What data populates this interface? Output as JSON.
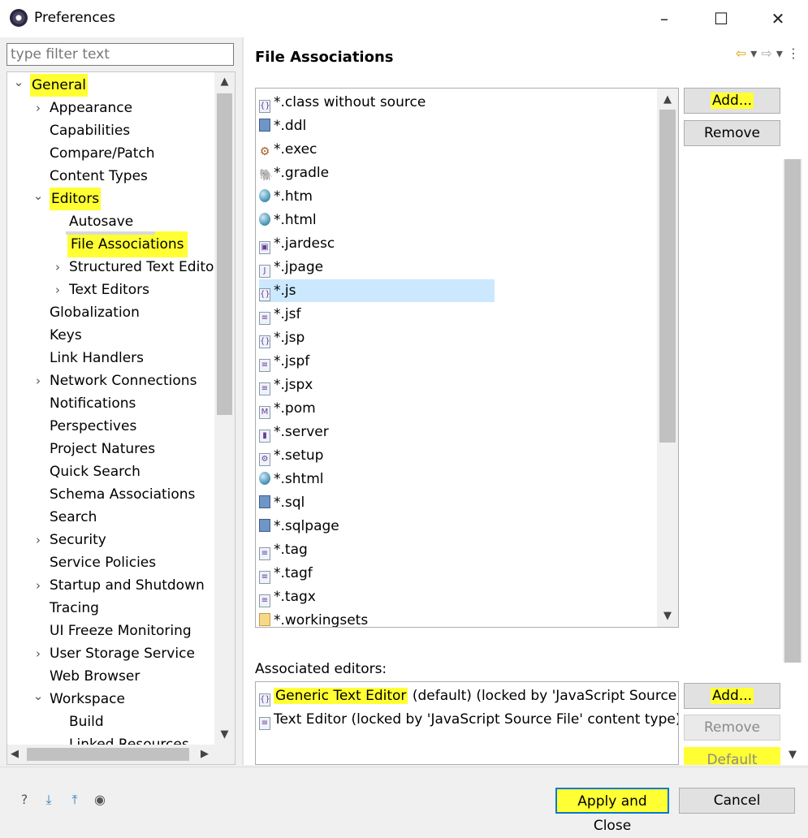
{
  "window": {
    "title": "Preferences",
    "controls": [
      "–",
      "☐",
      "✕"
    ]
  },
  "filter": {
    "placeholder": "type filter text"
  },
  "tree": {
    "items": [
      {
        "label": "General",
        "twisty": "expanded",
        "highlight": true
      },
      {
        "label": "Appearance",
        "twisty": "collapsed"
      },
      {
        "label": "Capabilities",
        "twisty": "none"
      },
      {
        "label": "Compare/Patch",
        "twisty": "none"
      },
      {
        "label": "Content Types",
        "twisty": "none"
      },
      {
        "label": "Editors",
        "twisty": "expanded",
        "highlight": true
      },
      {
        "label": "Autosave",
        "twisty": "none"
      },
      {
        "label": "File Associations",
        "twisty": "none",
        "highlight": true,
        "selected": true
      },
      {
        "label": "Structured Text Editors",
        "twisty": "collapsed"
      },
      {
        "label": "Text Editors",
        "twisty": "collapsed"
      },
      {
        "label": "Globalization",
        "twisty": "none"
      },
      {
        "label": "Keys",
        "twisty": "none"
      },
      {
        "label": "Link Handlers",
        "twisty": "none"
      },
      {
        "label": "Network Connections",
        "twisty": "collapsed"
      },
      {
        "label": "Notifications",
        "twisty": "none"
      },
      {
        "label": "Perspectives",
        "twisty": "none"
      },
      {
        "label": "Project Natures",
        "twisty": "none"
      },
      {
        "label": "Quick Search",
        "twisty": "none"
      },
      {
        "label": "Schema Associations",
        "twisty": "none"
      },
      {
        "label": "Search",
        "twisty": "none"
      },
      {
        "label": "Security",
        "twisty": "collapsed"
      },
      {
        "label": "Service Policies",
        "twisty": "none"
      },
      {
        "label": "Startup and Shutdown",
        "twisty": "collapsed"
      },
      {
        "label": "Tracing",
        "twisty": "none"
      },
      {
        "label": "UI Freeze Monitoring",
        "twisty": "none"
      },
      {
        "label": "User Storage Service",
        "twisty": "collapsed"
      },
      {
        "label": "Web Browser",
        "twisty": "none"
      },
      {
        "label": "Workspace",
        "twisty": "expanded"
      },
      {
        "label": "Build",
        "twisty": "none"
      },
      {
        "label": "Linked Resources",
        "twisty": "none"
      }
    ]
  },
  "page": {
    "heading": "File Associations",
    "file_types": [
      {
        "label": "*.class without source",
        "icon": "class-icon"
      },
      {
        "label": "*.ddl",
        "icon": "db-file-icon"
      },
      {
        "label": "*.exec",
        "icon": "gear-icon"
      },
      {
        "label": "*.gradle",
        "icon": "gradle-elephant-icon"
      },
      {
        "label": "*.htm",
        "icon": "globe-icon"
      },
      {
        "label": "*.html",
        "icon": "globe-icon"
      },
      {
        "label": "*.jardesc",
        "icon": "jar-icon"
      },
      {
        "label": "*.jpage",
        "icon": "java-page-icon"
      },
      {
        "label": "*.js",
        "icon": "js-file-icon",
        "selected": true
      },
      {
        "label": "*.jsf",
        "icon": "text-file-icon"
      },
      {
        "label": "*.jsp",
        "icon": "js-file-icon"
      },
      {
        "label": "*.jspf",
        "icon": "text-file-icon"
      },
      {
        "label": "*.jspx",
        "icon": "text-file-icon"
      },
      {
        "label": "*.pom",
        "icon": "maven-icon"
      },
      {
        "label": "*.server",
        "icon": "server-icon"
      },
      {
        "label": "*.setup",
        "icon": "setup-icon"
      },
      {
        "label": "*.shtml",
        "icon": "globe-icon"
      },
      {
        "label": "*.sql",
        "icon": "db-file-icon"
      },
      {
        "label": "*.sqlpage",
        "icon": "db-file-icon"
      },
      {
        "label": "*.tag",
        "icon": "text-file-icon"
      },
      {
        "label": "*.tagf",
        "icon": "text-file-icon"
      },
      {
        "label": "*.tagx",
        "icon": "text-file-icon"
      },
      {
        "label": "*.workingsets",
        "icon": "folder-icon"
      }
    ],
    "add_label": "Add...",
    "remove_label": "Remove",
    "associated_label": "Associated editors:",
    "editors": [
      {
        "name": "Generic Text Editor",
        "rest": " (default) (locked by 'JavaScript Source File' content type) (l",
        "highlight": true
      },
      {
        "name": "Text Editor",
        "rest": " (locked by 'JavaScript Source File' content type) (l",
        "highlight": false
      }
    ],
    "editor_add_label": "Add...",
    "editor_remove_label": "Remove",
    "editor_default_label": "Default"
  },
  "footer": {
    "apply_close": "Apply and Close",
    "cancel": "Cancel"
  },
  "colors": {
    "highlight": "#ffff33",
    "selection": "#cce8ff",
    "focus": "#0078d7"
  }
}
